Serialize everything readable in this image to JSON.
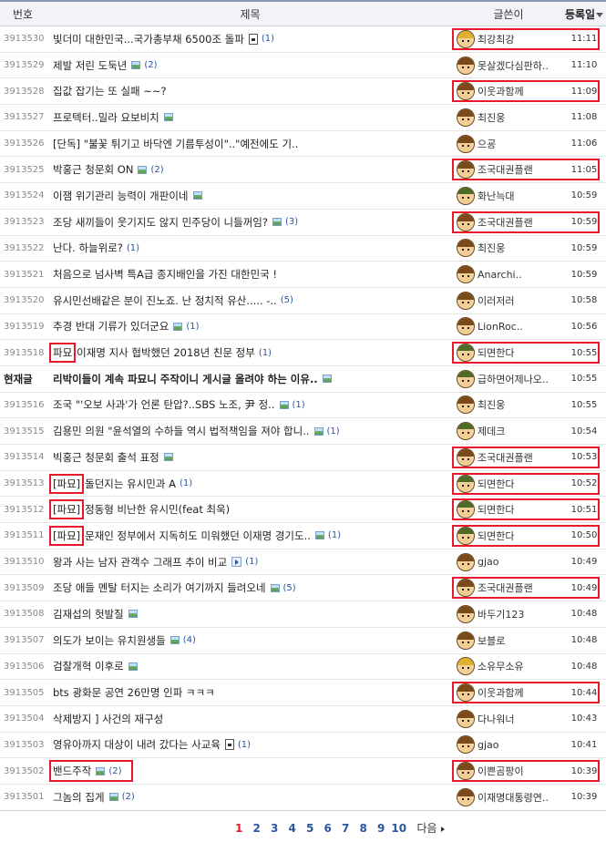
{
  "header": {
    "no": "번호",
    "title": "제목",
    "author": "글쓴이",
    "date": "등록일"
  },
  "posts": [
    {
      "no": "3913530",
      "prefix": "",
      "title": "빛더미 대한민국...국가총부채 6500조 돌파",
      "icon": "file",
      "comments": "(1)",
      "author": "최강최강",
      "avatar": "blond",
      "date": "11:11",
      "author_highlight": true,
      "title_highlight": false
    },
    {
      "no": "3913529",
      "prefix": "",
      "title": "제발 저린 도둑년",
      "icon": "image",
      "comments": "(2)",
      "author": "못살겠다심판하..",
      "avatar": "normal",
      "date": "11:10",
      "author_highlight": false,
      "title_highlight": false
    },
    {
      "no": "3913528",
      "prefix": "",
      "title": "집값 잡기는 또 실패 ~~?",
      "icon": "",
      "comments": "",
      "author": "이웃과함께",
      "avatar": "normal",
      "date": "11:09",
      "author_highlight": true,
      "title_highlight": false
    },
    {
      "no": "3913527",
      "prefix": "",
      "title": "프로텍터..밀라 요보비치",
      "icon": "image",
      "comments": "",
      "author": "최진웅",
      "avatar": "normal",
      "date": "11:08",
      "author_highlight": false,
      "title_highlight": false
    },
    {
      "no": "3913526",
      "prefix": "",
      "title": "[단독] \"불꽃 튀기고 바닥엔 기름투성이\"..\"예전에도 기..",
      "icon": "",
      "comments": "",
      "author": "으굥",
      "avatar": "normal",
      "date": "11:06",
      "author_highlight": false,
      "title_highlight": false
    },
    {
      "no": "3913525",
      "prefix": "",
      "title": "박홍근 청문회 ON",
      "icon": "image",
      "comments": "(2)",
      "author": "조국대권플랜",
      "avatar": "normal",
      "date": "11:05",
      "author_highlight": true,
      "title_highlight": false
    },
    {
      "no": "3913524",
      "prefix": "",
      "title": "이잼 위기관리 능력이 개판이네",
      "icon": "image",
      "comments": "",
      "author": "화난늑대",
      "avatar": "soldier",
      "date": "10:59",
      "author_highlight": false,
      "title_highlight": false
    },
    {
      "no": "3913523",
      "prefix": "",
      "title": "조당 새끼들이 웃기지도 않지 민주당이 니들꺼임?",
      "icon": "image",
      "comments": "(3)",
      "author": "조국대권플랜",
      "avatar": "normal",
      "date": "10:59",
      "author_highlight": true,
      "title_highlight": false
    },
    {
      "no": "3913522",
      "prefix": "",
      "title": "난다. 하늘위로?",
      "icon": "",
      "comments": "(1)",
      "author": "최진웅",
      "avatar": "normal",
      "date": "10:59",
      "author_highlight": false,
      "title_highlight": false
    },
    {
      "no": "3913521",
      "prefix": "",
      "title": "처음으로 넘사벽 특A급 종지배인을 가진 대한민국 !",
      "icon": "",
      "comments": "",
      "author": "Anarchi..",
      "avatar": "normal",
      "date": "10:59",
      "author_highlight": false,
      "title_highlight": false
    },
    {
      "no": "3913520",
      "prefix": "",
      "title": "유시민선배같은 분이 진노죠. 난 정치적 유산..... -..",
      "icon": "",
      "comments": "(5)",
      "author": "이러저러",
      "avatar": "normal",
      "date": "10:58",
      "author_highlight": false,
      "title_highlight": false
    },
    {
      "no": "3913519",
      "prefix": "",
      "title": "추경 반대 기류가 있더군요",
      "icon": "image",
      "comments": "(1)",
      "author": "LionRoc..",
      "avatar": "normal",
      "date": "10:56",
      "author_highlight": false,
      "title_highlight": false
    },
    {
      "no": "3913518",
      "prefix": "파묘",
      "title": "이재명 지사 협박했던 2018년 친문 정부",
      "icon": "",
      "comments": "(1)",
      "author": "되면한다",
      "avatar": "soldier",
      "date": "10:55",
      "author_highlight": true,
      "title_highlight": false
    },
    {
      "no": "현재글",
      "prefix": "",
      "title": "리박이들이 계속 파묘니 주작이니 게시글 올려야 하는 이유..",
      "icon": "image",
      "comments": "",
      "author": "급하면어제나오..",
      "avatar": "soldier",
      "date": "10:55",
      "author_highlight": false,
      "title_highlight": false,
      "current": true
    },
    {
      "no": "3913516",
      "prefix": "",
      "title": "조국 \"'오보 사과'가 언론 탄압?..SBS 노조, 尹 정..",
      "icon": "image",
      "comments": "(1)",
      "author": "최진웅",
      "avatar": "normal",
      "date": "10:55",
      "author_highlight": false,
      "title_highlight": false
    },
    {
      "no": "3913515",
      "prefix": "",
      "title": "김용민 의원 \"윤석열의 수하들 역시 법적책임을 져야 합니..",
      "icon": "image",
      "comments": "(1)",
      "author": "제데크",
      "avatar": "soldier",
      "date": "10:54",
      "author_highlight": false,
      "title_highlight": false
    },
    {
      "no": "3913514",
      "prefix": "",
      "title": "빅홍근 청문회 출석 표정",
      "icon": "image",
      "comments": "",
      "author": "조국대권플랜",
      "avatar": "normal",
      "date": "10:53",
      "author_highlight": true,
      "title_highlight": false
    },
    {
      "no": "3913513",
      "prefix": "[파묘]",
      "title": "돌던지는 유시민과 A",
      "icon": "",
      "comments": "(1)",
      "author": "되면한다",
      "avatar": "soldier",
      "date": "10:52",
      "author_highlight": true,
      "title_highlight": false
    },
    {
      "no": "3913512",
      "prefix": "[파묘]",
      "title": "정동형 비난한 유시민(feat 최욱)",
      "icon": "",
      "comments": "",
      "author": "되면한다",
      "avatar": "soldier",
      "date": "10:51",
      "author_highlight": true,
      "title_highlight": false
    },
    {
      "no": "3913511",
      "prefix": "[파묘]",
      "title": "문재인 정부에서 지독히도 미워했던 이재명 경기도..",
      "icon": "image",
      "comments": "(1)",
      "author": "되면한다",
      "avatar": "soldier",
      "date": "10:50",
      "author_highlight": true,
      "title_highlight": false
    },
    {
      "no": "3913510",
      "prefix": "",
      "title": "왕과 사는 남자 관객수 그래프 추이 비교",
      "icon": "video",
      "comments": "(1)",
      "author": "gjao",
      "avatar": "normal",
      "date": "10:49",
      "author_highlight": false,
      "title_highlight": false
    },
    {
      "no": "3913509",
      "prefix": "",
      "title": "조당 애들 멘탈 터지는 소리가 여기까지 들려오네",
      "icon": "image",
      "comments": "(5)",
      "author": "조국대권플랜",
      "avatar": "normal",
      "date": "10:49",
      "author_highlight": true,
      "title_highlight": false
    },
    {
      "no": "3913508",
      "prefix": "",
      "title": "김재섭의 헛발질",
      "icon": "image",
      "comments": "",
      "author": "바두기123",
      "avatar": "normal",
      "date": "10:48",
      "author_highlight": false,
      "title_highlight": false
    },
    {
      "no": "3913507",
      "prefix": "",
      "title": "의도가 보이는 유치원생들",
      "icon": "image",
      "comments": "(4)",
      "author": "보블로",
      "avatar": "normal",
      "date": "10:48",
      "author_highlight": false,
      "title_highlight": false
    },
    {
      "no": "3913506",
      "prefix": "",
      "title": "검찰개혁 이후로",
      "icon": "image",
      "comments": "",
      "author": "소유무소유",
      "avatar": "blond",
      "date": "10:48",
      "author_highlight": false,
      "title_highlight": false
    },
    {
      "no": "3913505",
      "prefix": "",
      "title": "bts 광화문 공연 26만명 인파 ㅋㅋㅋ",
      "icon": "",
      "comments": "",
      "author": "이웃과함께",
      "avatar": "normal",
      "date": "10:44",
      "author_highlight": true,
      "title_highlight": false
    },
    {
      "no": "3913504",
      "prefix": "",
      "title": "삭제방지 ] 사건의 재구성",
      "icon": "",
      "comments": "",
      "author": "다나워너",
      "avatar": "normal",
      "date": "10:43",
      "author_highlight": false,
      "title_highlight": false
    },
    {
      "no": "3913503",
      "prefix": "",
      "title": "영유아까지 대상이 내려 갔다는 사교육",
      "icon": "file",
      "comments": "(1)",
      "author": "gjao",
      "avatar": "normal",
      "date": "10:41",
      "author_highlight": false,
      "title_highlight": false
    },
    {
      "no": "3913502",
      "prefix": "",
      "title": "밴드주작",
      "icon": "image",
      "comments": "(2)",
      "author": "이쁜곰팡이",
      "avatar": "normal",
      "date": "10:39",
      "author_highlight": true,
      "title_highlight": true
    },
    {
      "no": "3913501",
      "prefix": "",
      "title": "그놈의 집게",
      "icon": "image",
      "comments": "(2)",
      "author": "이재명대통령연..",
      "avatar": "normal",
      "date": "10:39",
      "author_highlight": false,
      "title_highlight": false
    }
  ],
  "pagination": {
    "pages": [
      "1",
      "2",
      "3",
      "4",
      "5",
      "6",
      "7",
      "8",
      "9",
      "10"
    ],
    "current": "1",
    "next_label": "다음"
  },
  "colors": {
    "highlight": "#e8192c",
    "comment": "#2a55a0",
    "header_bg": "#f1f3f7"
  }
}
